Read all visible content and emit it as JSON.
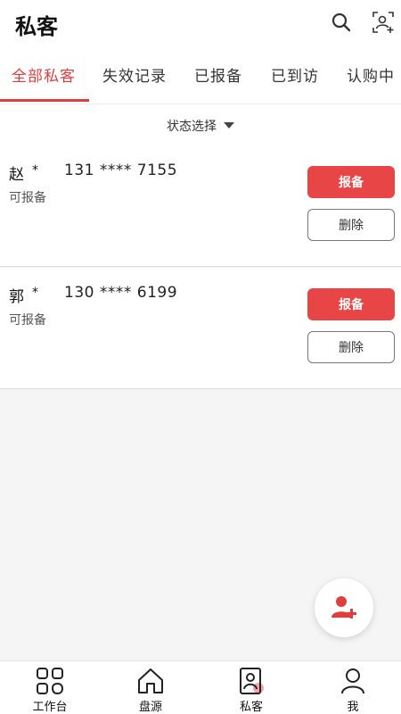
{
  "header": {
    "title": "私客",
    "search_icon": "search-icon",
    "scan_icon": "contact-scan-icon"
  },
  "tabs": [
    {
      "label": "全部私客",
      "active": true
    },
    {
      "label": "失效记录",
      "active": false
    },
    {
      "label": "已报备",
      "active": false
    },
    {
      "label": "已到访",
      "active": false
    },
    {
      "label": "认购中",
      "active": false
    }
  ],
  "filter": {
    "label": "状态选择"
  },
  "customers": [
    {
      "name": "赵",
      "mask": "*",
      "phone": "131 **** 7155",
      "status": "可报备",
      "report_label": "报备",
      "delete_label": "删除"
    },
    {
      "name": "郭",
      "mask": "*",
      "phone": "130 **** 6199",
      "status": "可报备",
      "report_label": "报备",
      "delete_label": "删除"
    }
  ],
  "fab": {
    "icon": "add-user-icon"
  },
  "bottom_nav": [
    {
      "label": "工作台",
      "icon": "grid-icon"
    },
    {
      "label": "盘源",
      "icon": "home-icon"
    },
    {
      "label": "私客",
      "icon": "contact-card-icon"
    },
    {
      "label": "我",
      "icon": "user-icon"
    }
  ],
  "colors": {
    "accent": "#e23d3d",
    "button": "#e84646"
  }
}
